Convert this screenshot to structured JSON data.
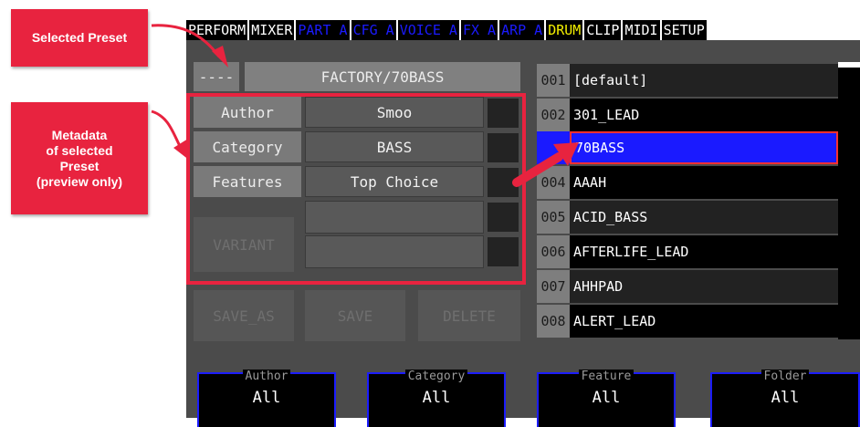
{
  "annotations": {
    "selected_preset": "Selected Preset",
    "metadata": [
      "Metadata",
      "of selected",
      "Preset",
      "(preview only)"
    ]
  },
  "tabs": [
    {
      "label": "PERFORM",
      "color": "#ffffff"
    },
    {
      "label": "MIXER",
      "color": "#ffffff"
    },
    {
      "label": "PART A",
      "color": "#1b1bff"
    },
    {
      "label": "CFG A",
      "color": "#1b1bff"
    },
    {
      "label": "VOICE A",
      "color": "#1b1bff"
    },
    {
      "label": "FX A",
      "color": "#1b1bff"
    },
    {
      "label": "ARP A",
      "color": "#1b1bff"
    },
    {
      "label": "DRUM",
      "color": "#f4f000"
    },
    {
      "label": "CLIP",
      "color": "#ffffff"
    },
    {
      "label": "MIDI",
      "color": "#ffffff"
    },
    {
      "label": "SETUP",
      "color": "#ffffff"
    }
  ],
  "preset": {
    "selector": "----",
    "name": "FACTORY/70BASS"
  },
  "metadata": {
    "author_label": "Author",
    "author_value": "Smoo",
    "category_label": "Category",
    "category_value": "BASS",
    "features_label": "Features",
    "features_value": "Top Choice"
  },
  "buttons": {
    "variant": "VARIANT",
    "save_as": "SAVE_AS",
    "save": "SAVE",
    "delete": "DELETE"
  },
  "preset_list": [
    {
      "num": "001",
      "name": "[default]"
    },
    {
      "num": "002",
      "name": "301_LEAD"
    },
    {
      "num": "",
      "name": "70BASS",
      "selected": true
    },
    {
      "num": "004",
      "name": "AAAH"
    },
    {
      "num": "005",
      "name": "ACID_BASS"
    },
    {
      "num": "006",
      "name": "AFTERLIFE_LEAD"
    },
    {
      "num": "007",
      "name": "AHHPAD"
    },
    {
      "num": "008",
      "name": "ALERT_LEAD"
    }
  ],
  "filters": {
    "author": {
      "label": "Author",
      "value": "All"
    },
    "category": {
      "label": "Category",
      "value": "All"
    },
    "feature": {
      "label": "Feature",
      "value": "All"
    },
    "folder": {
      "label": "Folder",
      "value": "All"
    }
  },
  "colors": {
    "callout": "#e8233f",
    "selection": "#1a1aff",
    "panel": "#4b4b4b"
  }
}
